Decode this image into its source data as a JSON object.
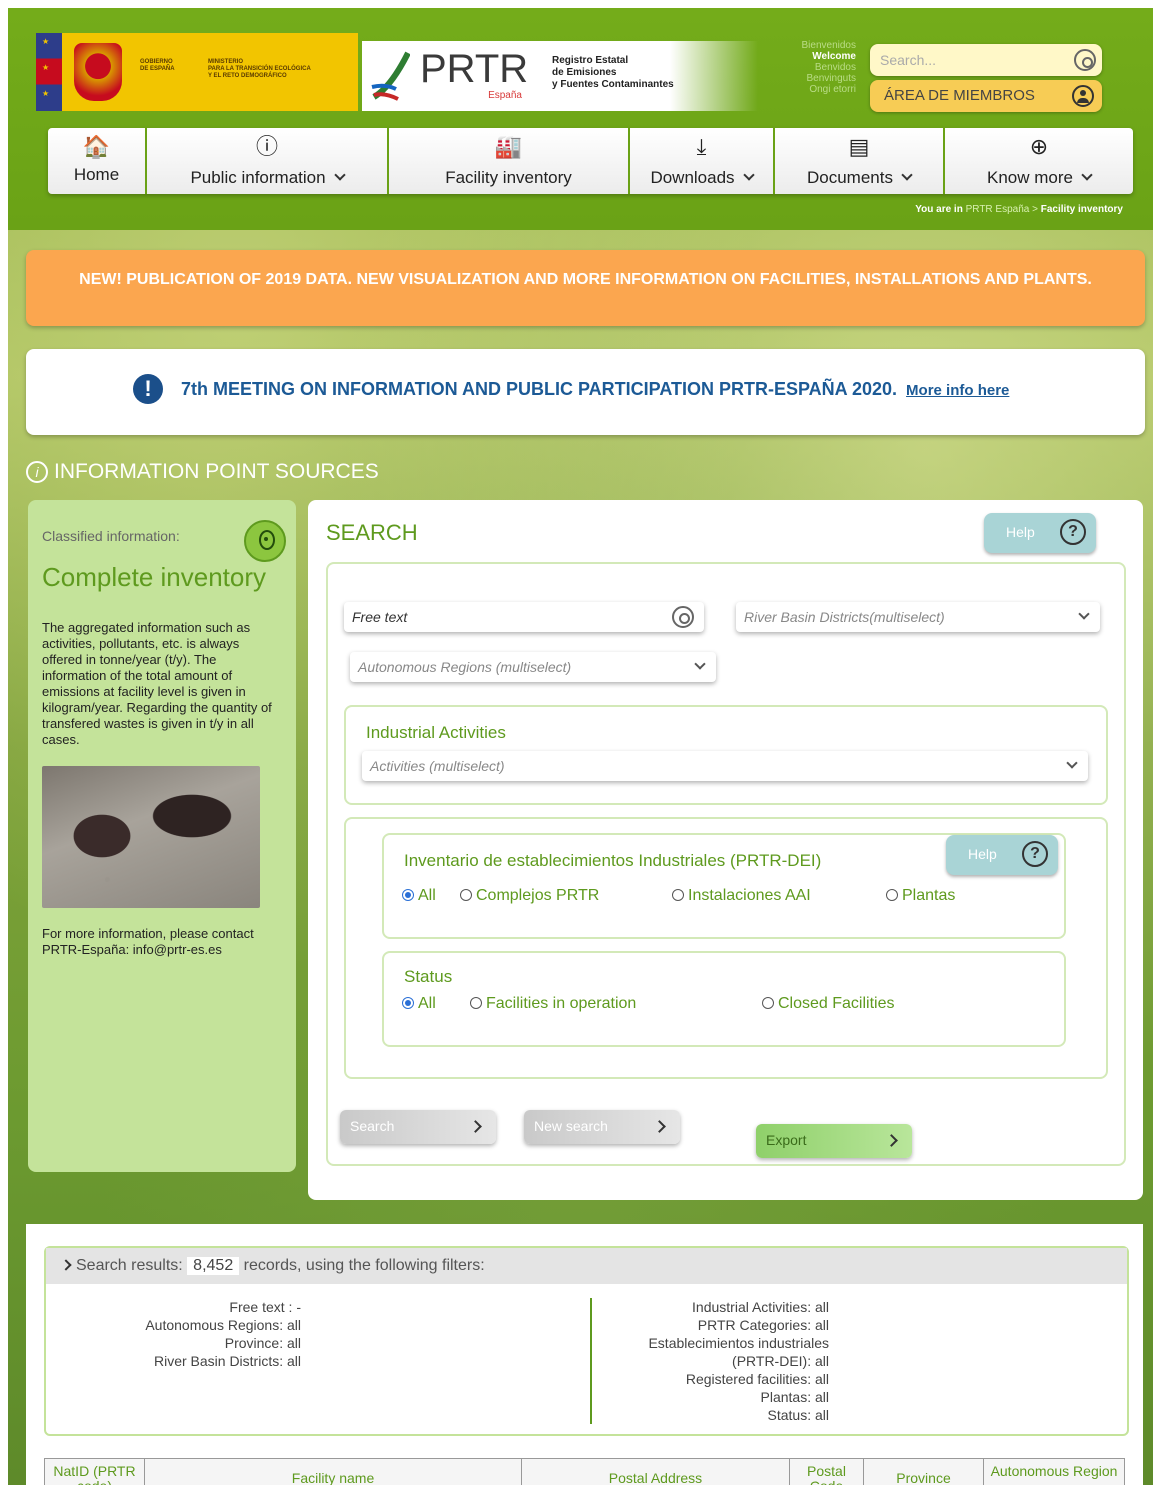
{
  "header": {
    "gov_text_1": "GOBIERNO\nDE ESPAÑA",
    "gov_text_2": "MINISTERIO\nPARA LA TRANSICIÓN ECOLÓGICA\nY EL RETO DEMOGRÁFICO",
    "prtr_word": "PRTR",
    "prtr_espana": "España",
    "registro": "Registro Estatal\nde Emisiones\ny Fuentes Contaminantes",
    "welcome": [
      "Bienvenidos",
      "Welcome",
      "Benvidos",
      "Benvinguts",
      "Ongi etorri"
    ],
    "search_placeholder": "Search...",
    "members_label": "ÁREA DE MIEMBROS"
  },
  "nav": [
    {
      "label": "Home",
      "icon": "home-icon",
      "glyph": "🏠",
      "dropdown": false
    },
    {
      "label": "Public information",
      "icon": "info-icon",
      "glyph": "ⓘ",
      "dropdown": true
    },
    {
      "label": "Facility inventory",
      "icon": "factory-icon",
      "glyph": "🏭",
      "dropdown": false
    },
    {
      "label": "Downloads",
      "icon": "download-icon",
      "glyph": "⤓",
      "dropdown": true
    },
    {
      "label": "Documents",
      "icon": "documents-icon",
      "glyph": "▤",
      "dropdown": true
    },
    {
      "label": "Know more",
      "icon": "zoom-in-icon",
      "glyph": "⊕",
      "dropdown": true
    }
  ],
  "breadcrumb": {
    "prefix": "You are in",
    "link": "PRTR España >",
    "current": "Facility inventory"
  },
  "banner": {
    "text": "NEW! PUBLICATION OF 2019 DATA. NEW VISUALIZATION AND MORE INFORMATION ON FACILITIES, INSTALLATIONS AND PLANTS."
  },
  "meeting": {
    "text": "7th MEETING ON INFORMATION AND PUBLIC PARTICIPATION PRTR-ESPAÑA 2020.",
    "link": "More info here"
  },
  "section_title": "INFORMATION POINT SOURCES",
  "left_panel": {
    "label": "Classified information:",
    "title": "Complete inventory",
    "text": "The aggregated information such as activities, pollutants, etc. is always offered in tonne/year (t/y). The information of the total amount of emissions at facility level is given in kilogram/year. Regarding the quantity of transfered wastes is given in t/y in all cases.",
    "contact": "For more information, please contact PRTR-España: info@prtr-es.es"
  },
  "search": {
    "title": "SEARCH",
    "help": "Help",
    "free_text": "Free text",
    "river_basin": "River Basin Districts(multiselect)",
    "autonomous": "Autonomous Regions (multiselect)",
    "industrial_label": "Industrial Activities",
    "activities": "Activities (multiselect)",
    "dei_label": "Inventario de establecimientos Industriales (PRTR-DEI)",
    "dei_options": [
      "All",
      "Complejos PRTR",
      "Instalaciones AAI",
      "Plantas"
    ],
    "status_label": "Status",
    "status_options": [
      "All",
      "Facilities in operation",
      "Closed Facilities"
    ],
    "search_btn": "Search",
    "new_search_btn": "New search",
    "export_btn": "Export"
  },
  "results": {
    "prefix": "Search results:",
    "count": "8,452",
    "suffix": "records, using the following filters:",
    "left_filters": [
      "Free text : -",
      "Autonomous Regions: all",
      "Province: all",
      "River Basin Districts: all"
    ],
    "right_filters": [
      "Industrial Activities: all",
      "PRTR Categories: all",
      "Establecimientos industriales",
      "(PRTR-DEI): all",
      "Registered facilities: all",
      "Plantas: all",
      "Status: all"
    ],
    "columns": [
      "NatID (PRTR code)",
      "Facility name",
      "Postal Address",
      "Postal Code",
      "Province",
      "Autonomous Region"
    ]
  }
}
